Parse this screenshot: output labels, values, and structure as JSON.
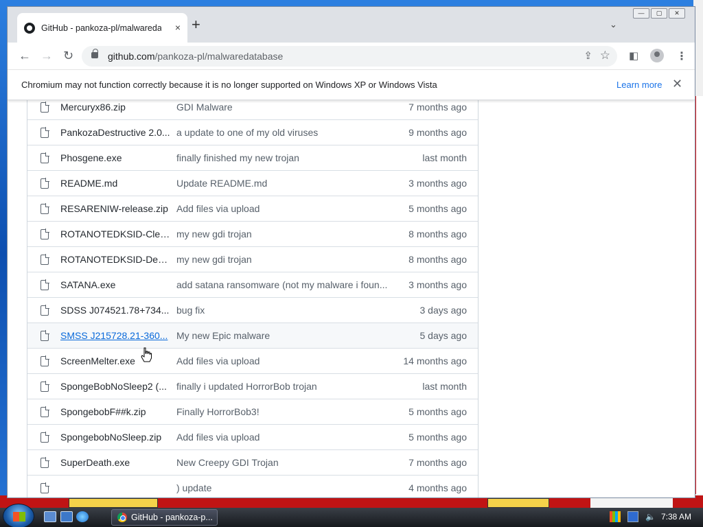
{
  "browser": {
    "tab_title": "GitHub - pankoza-pl/malwaredatabase",
    "new_tab": "+",
    "tab_close": "×",
    "url_domain": "github.com",
    "url_path": "/pankoza-pl/malwaredatabase"
  },
  "infobar": {
    "message": "Chromium may not function correctly because it is no longer supported on Windows XP or Windows Vista",
    "learn_more": "Learn more",
    "close": "✕"
  },
  "files": [
    {
      "name": "Mercuryx86.zip",
      "message": "GDI Malware",
      "age": "7 months ago",
      "link": false
    },
    {
      "name": "PankozaDestructive 2.0...",
      "message": "a update to one of my old viruses",
      "age": "9 months ago",
      "link": false
    },
    {
      "name": "Phosgene.exe",
      "message": "finally finished my new trojan",
      "age": "last month",
      "link": false
    },
    {
      "name": "README.md",
      "message": "Update README.md",
      "age": "3 months ago",
      "link": false
    },
    {
      "name": "RESARENIW-release.zip",
      "message": "Add files via upload",
      "age": "5 months ago",
      "link": false
    },
    {
      "name": "ROTANOTEDKSID-Clea...",
      "message": "my new gdi trojan",
      "age": "8 months ago",
      "link": false
    },
    {
      "name": "ROTANOTEDKSID-Dest...",
      "message": "my new gdi trojan",
      "age": "8 months ago",
      "link": false
    },
    {
      "name": "SATANA.exe",
      "message": "add satana ransomware (not my malware i foun...",
      "age": "3 months ago",
      "link": false
    },
    {
      "name": "SDSS J074521.78+734...",
      "message": "bug fix",
      "age": "3 days ago",
      "link": false
    },
    {
      "name": "SMSS J215728.21-360...",
      "message": "My new Epic malware",
      "age": "5 days ago",
      "link": true
    },
    {
      "name": "ScreenMelter.exe",
      "message": "Add files via upload",
      "age": "14 months ago",
      "link": false
    },
    {
      "name": "SpongeBobNoSleep2 (...",
      "message": "finally i updated HorrorBob trojan",
      "age": "last month",
      "link": false
    },
    {
      "name": "SpongebobF##k.zip",
      "message": "Finally HorrorBob3!",
      "age": "5 months ago",
      "link": false
    },
    {
      "name": "SpongebobNoSleep.zip",
      "message": "Add files via upload",
      "age": "5 months ago",
      "link": false
    },
    {
      "name": "SuperDeath.exe",
      "message": "New Creepy GDI Trojan",
      "age": "7 months ago",
      "link": false
    },
    {
      "name": "",
      "message": ") update",
      "age": "4 months ago",
      "link": false
    }
  ],
  "taskbar": {
    "task_label": "GitHub - pankoza-p...",
    "clock": "7:38 AM"
  },
  "icons": {
    "back": "back-arrow-icon",
    "forward": "forward-arrow-icon",
    "reload": "reload-icon",
    "lock": "lock-icon",
    "share": "share-icon",
    "star": "bookmark-star-icon",
    "sidepanel": "side-panel-icon",
    "profile": "profile-icon",
    "menu": "kebab-menu-icon",
    "file": "file-icon"
  },
  "colors": {
    "link": "#0969da",
    "learn_more": "#1a73e8"
  }
}
